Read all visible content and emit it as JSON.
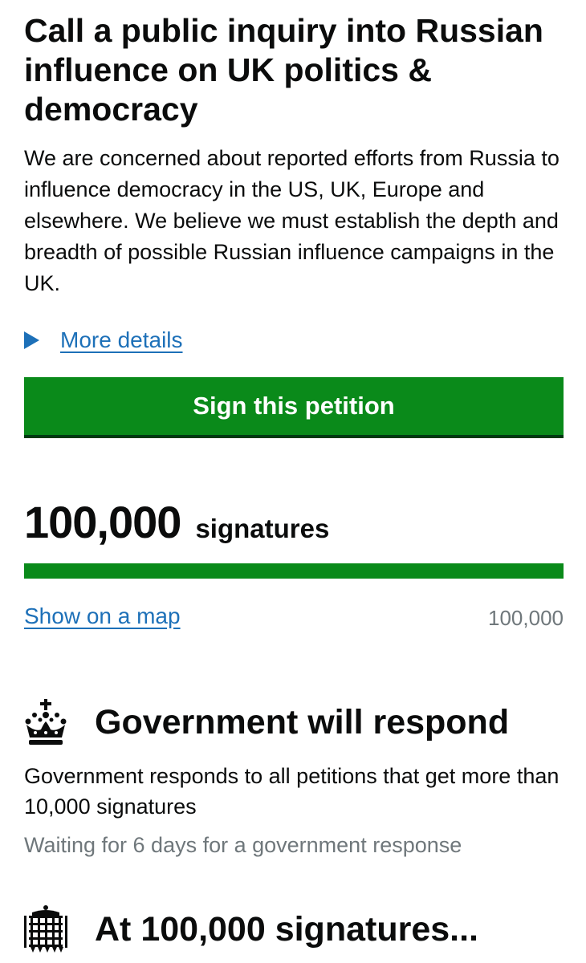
{
  "petition": {
    "title": "Call a public inquiry into Russian influence on UK politics & democracy",
    "summary": "We are concerned about reported efforts from Russia to influence democracy in the US, UK, Europe and elsewhere. We believe we must establish the depth and breadth of possible Russian influence campaigns in the UK.",
    "more_details_label": "More details",
    "sign_button_label": "Sign this petition"
  },
  "signatures": {
    "count": "100,000",
    "unit_label": "signatures",
    "target": "100,000",
    "progress_fraction": 1.0,
    "map_link_label": "Show on a map"
  },
  "government_response": {
    "heading": "Government will respond",
    "icon": "crown-icon",
    "body": "Government responds to all petitions that get more than 10,000 signatures",
    "status": "Waiting for 6 days for a government response"
  },
  "debate": {
    "heading": "At 100,000 signatures...",
    "icon": "portcullis-icon"
  },
  "colors": {
    "brand_green": "#0a8a1a",
    "link_blue": "#1d70b8",
    "secondary_text": "#6f777b",
    "text": "#0b0c0c"
  }
}
